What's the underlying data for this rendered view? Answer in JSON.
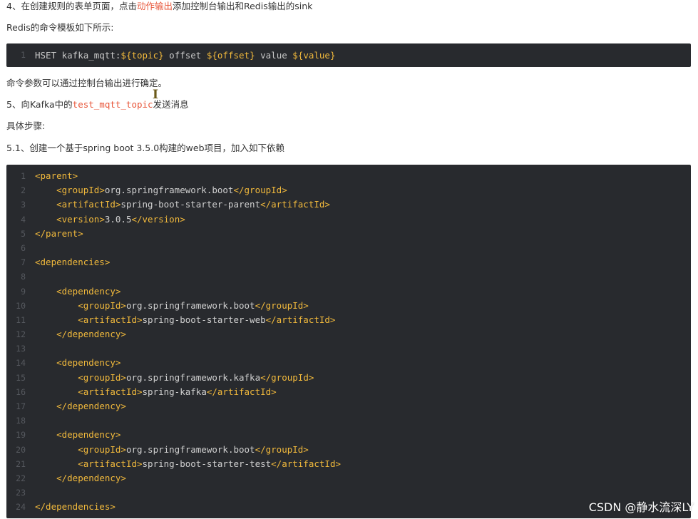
{
  "step4": {
    "prefix": "4、在创建规则的表单页面，点击",
    "highlight": "动作输出",
    "suffix": "添加控制台输出和Redis输出的sink"
  },
  "redis_template_label": "Redis的命令模板如下所示:",
  "redis_code": {
    "line_number": "1",
    "part1": "HSET kafka_mqtt:",
    "var1": "${topic}",
    "part2": " offset ",
    "var2": "${offset}",
    "part3": " value ",
    "var3": "${value}"
  },
  "command_params_note": "命令参数可以通过控制台输出进行确定。",
  "step5": {
    "prefix": "5、向Kafka中的",
    "topic": "test_mqtt_topic",
    "suffix": "发送消息"
  },
  "steps_label": "具体步骤:",
  "step5_1": "5.1、创建一个基于spring boot 3.5.0构建的web项目，加入如下依赖",
  "pom_code": [
    {
      "n": "1",
      "indent": "",
      "open": "<parent>",
      "text": "",
      "close": ""
    },
    {
      "n": "2",
      "indent": "    ",
      "open": "<groupId>",
      "text": "org.springframework.boot",
      "close": "</groupId>"
    },
    {
      "n": "3",
      "indent": "    ",
      "open": "<artifactId>",
      "text": "spring-boot-starter-parent",
      "close": "</artifactId>"
    },
    {
      "n": "4",
      "indent": "    ",
      "open": "<version>",
      "text": "3.0.5",
      "close": "</version>"
    },
    {
      "n": "5",
      "indent": "",
      "open": "</parent>",
      "text": "",
      "close": ""
    },
    {
      "n": "6",
      "indent": "",
      "open": "",
      "text": "",
      "close": ""
    },
    {
      "n": "7",
      "indent": "",
      "open": "<dependencies>",
      "text": "",
      "close": ""
    },
    {
      "n": "8",
      "indent": "",
      "open": "",
      "text": "",
      "close": ""
    },
    {
      "n": "9",
      "indent": "    ",
      "open": "<dependency>",
      "text": "",
      "close": ""
    },
    {
      "n": "10",
      "indent": "        ",
      "open": "<groupId>",
      "text": "org.springframework.boot",
      "close": "</groupId>"
    },
    {
      "n": "11",
      "indent": "        ",
      "open": "<artifactId>",
      "text": "spring-boot-starter-web",
      "close": "</artifactId>"
    },
    {
      "n": "12",
      "indent": "    ",
      "open": "</dependency>",
      "text": "",
      "close": ""
    },
    {
      "n": "13",
      "indent": "",
      "open": "",
      "text": "",
      "close": ""
    },
    {
      "n": "14",
      "indent": "    ",
      "open": "<dependency>",
      "text": "",
      "close": ""
    },
    {
      "n": "15",
      "indent": "        ",
      "open": "<groupId>",
      "text": "org.springframework.kafka",
      "close": "</groupId>"
    },
    {
      "n": "16",
      "indent": "        ",
      "open": "<artifactId>",
      "text": "spring-kafka",
      "close": "</artifactId>"
    },
    {
      "n": "17",
      "indent": "    ",
      "open": "</dependency>",
      "text": "",
      "close": ""
    },
    {
      "n": "18",
      "indent": "",
      "open": "",
      "text": "",
      "close": ""
    },
    {
      "n": "19",
      "indent": "    ",
      "open": "<dependency>",
      "text": "",
      "close": ""
    },
    {
      "n": "20",
      "indent": "        ",
      "open": "<groupId>",
      "text": "org.springframework.boot",
      "close": "</groupId>"
    },
    {
      "n": "21",
      "indent": "        ",
      "open": "<artifactId>",
      "text": "spring-boot-starter-test",
      "close": "</artifactId>"
    },
    {
      "n": "22",
      "indent": "    ",
      "open": "</dependency>",
      "text": "",
      "close": ""
    },
    {
      "n": "23",
      "indent": "",
      "open": "",
      "text": "",
      "close": ""
    },
    {
      "n": "24",
      "indent": "",
      "open": "</dependencies>",
      "text": "",
      "close": ""
    }
  ],
  "text_cursor_icon": "text-cursor-icon",
  "watermark": "CSDN @静水流深LY",
  "colors": {
    "code_background": "#282a2e",
    "tag_color": "#f1b93c",
    "highlight_red": "#e8563a"
  }
}
